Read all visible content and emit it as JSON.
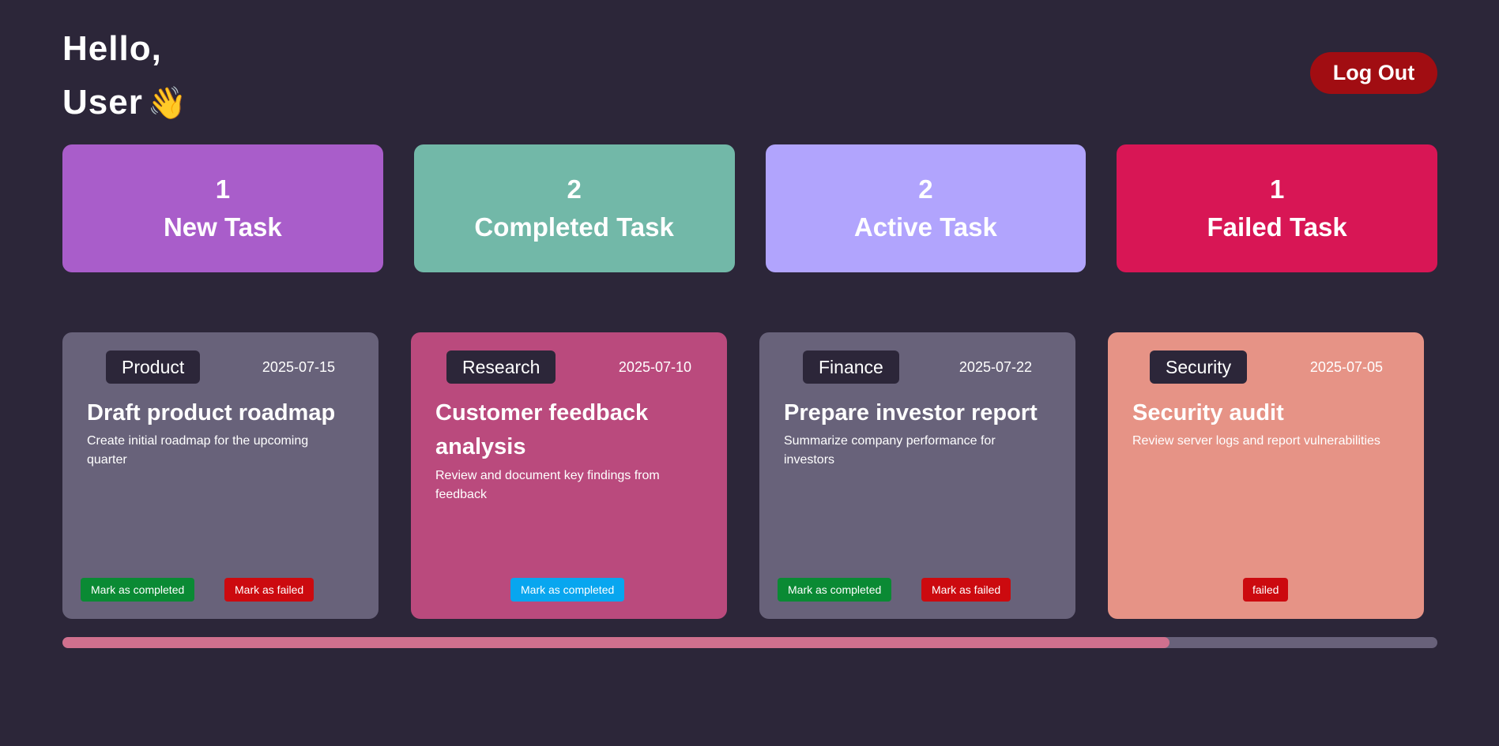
{
  "header": {
    "greeting_line1": "Hello,",
    "greeting_line2": "User",
    "wave_emoji": "👋",
    "logout_label": "Log Out"
  },
  "stats": [
    {
      "count": "1",
      "label": "New Task",
      "color": "#a95dca"
    },
    {
      "count": "2",
      "label": "Completed Task",
      "color": "#72b8a8"
    },
    {
      "count": "2",
      "label": "Active Task",
      "color": "#b1a4fd"
    },
    {
      "count": "1",
      "label": "Failed Task",
      "color": "#d81655"
    }
  ],
  "tasks": [
    {
      "category": "Product",
      "date": "2025-07-15",
      "title": "Draft product roadmap",
      "description": "Create initial roadmap for the upcoming quarter",
      "color": "#68627a",
      "actions": [
        {
          "label": "Mark as completed",
          "color": "#0a8a34"
        },
        {
          "label": "Mark as failed",
          "color": "#cc0a0f"
        }
      ]
    },
    {
      "category": "Research",
      "date": "2025-07-10",
      "title": "Customer feedback analysis",
      "description": "Review and document key findings from feedback",
      "color": "#ba4a7d",
      "actions": [
        {
          "label": "Mark as completed",
          "color": "#08a6ef"
        }
      ]
    },
    {
      "category": "Finance",
      "date": "2025-07-22",
      "title": "Prepare investor report",
      "description": "Summarize company performance for investors",
      "color": "#68627a",
      "actions": [
        {
          "label": "Mark as completed",
          "color": "#0a8a34"
        },
        {
          "label": "Mark as failed",
          "color": "#cc0a0f"
        }
      ]
    },
    {
      "category": "Security",
      "date": "2025-07-05",
      "title": "Security audit",
      "description": "Review server logs and report vulnerabilities",
      "color": "#e69386",
      "actions": [
        {
          "label": "failed",
          "color": "#cc0a0f"
        }
      ]
    }
  ],
  "scrollbar": {
    "thumb_fraction": 0.805
  }
}
